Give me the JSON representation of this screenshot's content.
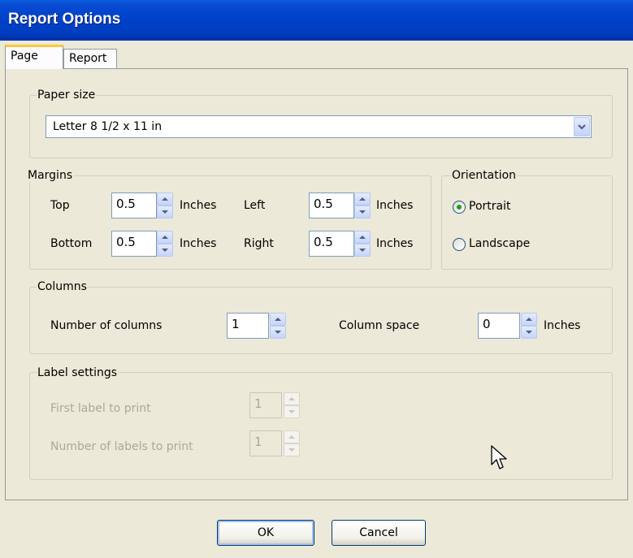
{
  "window": {
    "title": "Report Options"
  },
  "tabs": [
    {
      "label": "Page"
    },
    {
      "label": "Report"
    }
  ],
  "paper_size": {
    "legend": "Paper size",
    "selected": "Letter 8 1/2 x 11 in"
  },
  "margins": {
    "legend": "Margins",
    "top_label": "Top",
    "top_value": "0.5",
    "bottom_label": "Bottom",
    "bottom_value": "0.5",
    "left_label": "Left",
    "left_value": "0.5",
    "right_label": "Right",
    "right_value": "0.5",
    "unit": "Inches"
  },
  "orientation": {
    "legend": "Orientation",
    "options": [
      {
        "label": "Portrait",
        "selected": true
      },
      {
        "label": "Landscape",
        "selected": false
      }
    ]
  },
  "columns": {
    "legend": "Columns",
    "count_label": "Number of columns",
    "count_value": "1",
    "space_label": "Column space",
    "space_value": "0",
    "unit": "Inches"
  },
  "label_settings": {
    "legend": "Label settings",
    "first_label": "First label to print",
    "first_value": "1",
    "count_label": "Number of labels to print",
    "count_value": "1"
  },
  "buttons": {
    "ok": "OK",
    "cancel": "Cancel"
  },
  "colors": {
    "title_bar": "#0042cc",
    "dialog_bg": "#ece9d8",
    "tab_highlight": "#ffc83c",
    "radio_dot": "#21a121"
  },
  "icons": {
    "combo_arrow": "chevron-down-icon",
    "spin_up": "spin-up-icon",
    "spin_down": "spin-down-icon",
    "cursor": "mouse-pointer-icon"
  }
}
